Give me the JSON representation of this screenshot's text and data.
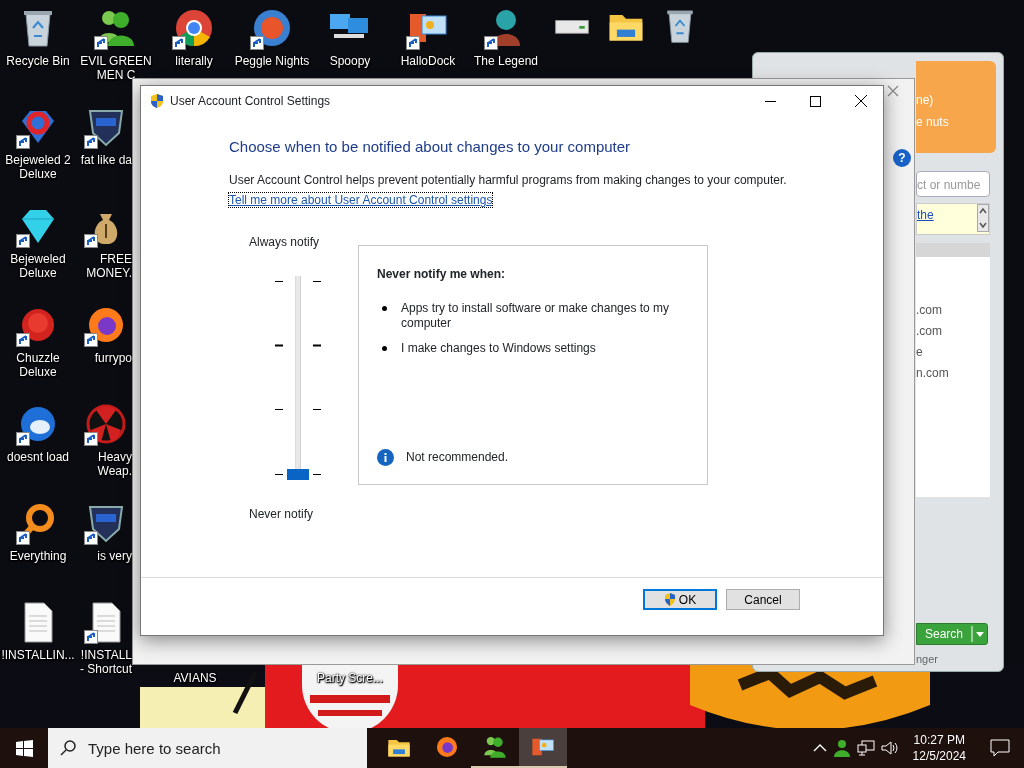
{
  "desktop_icons": [
    {
      "icons": [
        {
          "label": "Recycle Bin",
          "kind": "bin",
          "shortcut": false
        },
        {
          "label": "Bejeweled 2\nDeluxe",
          "kind": "gemred",
          "shortcut": true
        },
        {
          "label": "Bejeweled\nDeluxe",
          "kind": "gem",
          "shortcut": true
        },
        {
          "label": "Chuzzle\nDeluxe",
          "kind": "fuzz",
          "shortcut": true
        },
        {
          "label": "doesnt load",
          "kind": "bird",
          "shortcut": true
        },
        {
          "label": "Everything",
          "kind": "ring",
          "shortcut": true
        },
        {
          "label": "!INSTALLIN...",
          "kind": "doc",
          "shortcut": false
        }
      ]
    },
    {
      "icons": [
        {
          "label": "EVIL GREEN\nMEN C",
          "kind": "people",
          "shortcut": true
        },
        {
          "label": "fat like da",
          "kind": "shield",
          "shortcut": true
        },
        {
          "label": "FREE\nMONEY.",
          "kind": "bag",
          "shortcut": true
        },
        {
          "label": "furrypo",
          "kind": "fox",
          "shortcut": true
        },
        {
          "label": "Heavy\nWeap.",
          "kind": "hazard",
          "shortcut": true
        },
        {
          "label": "is very",
          "kind": "shield",
          "shortcut": true
        },
        {
          "label": "!INSTALL\n- Shortcut",
          "kind": "doc",
          "shortcut": true
        }
      ]
    },
    {
      "icons": [
        {
          "label": "literally",
          "kind": "browser",
          "shortcut": true
        }
      ]
    },
    {
      "icons": [
        {
          "label": "Peggle Nights",
          "kind": "ball",
          "shortcut": true
        }
      ]
    },
    {
      "icons": [
        {
          "label": "Spoopy",
          "kind": "computers",
          "shortcut": false
        }
      ]
    },
    {
      "icons": [
        {
          "label": "HalloDock",
          "kind": "panels",
          "shortcut": true
        }
      ]
    },
    {
      "icons": [
        {
          "label": "The Legend",
          "kind": "avatar",
          "shortcut": true
        }
      ]
    }
  ],
  "bottom_labels": [
    "AVIANS",
    "Party Scre..."
  ],
  "dock_icons": [
    {
      "kind": "drive"
    },
    {
      "kind": "folder"
    },
    {
      "kind": "bin"
    }
  ],
  "messenger": {
    "header_lines": [
      "ne)",
      "e nuts"
    ],
    "help": "?",
    "search_placeholder": "ct or numbe",
    "notice_link": "the",
    "contacts": [
      ".com",
      ".com",
      "e",
      "n.com"
    ],
    "search_button": "Search",
    "status": "nger"
  },
  "dialog": {
    "title": "User Account Control Settings",
    "heading": "Choose when to be notified about changes to your computer",
    "description": "User Account Control helps prevent potentially harmful programs from making changes to your computer.",
    "link": {
      "text": "Tell me more about User Account Control settings",
      "focused": true
    },
    "slider": {
      "top_label": "Always notify",
      "bottom_label": "Never notify",
      "level": 0
    },
    "info": {
      "title": "Never notify me when:",
      "bullets": [
        "Apps try to install software or make changes to my computer",
        "I make changes to Windows settings"
      ],
      "notice": "Not recommended."
    },
    "buttons": [
      {
        "label": "OK",
        "shield": true,
        "default": true
      },
      {
        "label": "Cancel",
        "shield": false,
        "default": false
      }
    ]
  },
  "taskbar": {
    "search_placeholder": "Type here to search",
    "apps": [
      {
        "kind": "folder",
        "running": false,
        "selected": false
      },
      {
        "kind": "fox",
        "running": false,
        "selected": false
      },
      {
        "kind": "people",
        "running": true,
        "selected": false
      },
      {
        "kind": "panels",
        "running": true,
        "selected": true
      }
    ],
    "time": "10:27 PM",
    "date": "12/5/2024"
  }
}
